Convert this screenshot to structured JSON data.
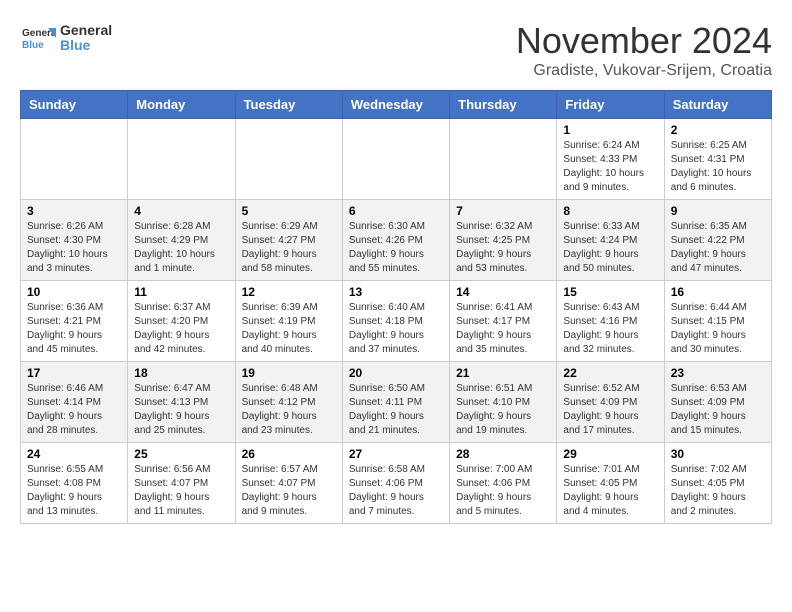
{
  "logo": {
    "text_general": "General",
    "text_blue": "Blue"
  },
  "title": "November 2024",
  "subtitle": "Gradiste, Vukovar-Srijem, Croatia",
  "weekdays": [
    "Sunday",
    "Monday",
    "Tuesday",
    "Wednesday",
    "Thursday",
    "Friday",
    "Saturday"
  ],
  "weeks": [
    [
      {
        "day": "",
        "info": ""
      },
      {
        "day": "",
        "info": ""
      },
      {
        "day": "",
        "info": ""
      },
      {
        "day": "",
        "info": ""
      },
      {
        "day": "",
        "info": ""
      },
      {
        "day": "1",
        "info": "Sunrise: 6:24 AM\nSunset: 4:33 PM\nDaylight: 10 hours and 9 minutes."
      },
      {
        "day": "2",
        "info": "Sunrise: 6:25 AM\nSunset: 4:31 PM\nDaylight: 10 hours and 6 minutes."
      }
    ],
    [
      {
        "day": "3",
        "info": "Sunrise: 6:26 AM\nSunset: 4:30 PM\nDaylight: 10 hours and 3 minutes."
      },
      {
        "day": "4",
        "info": "Sunrise: 6:28 AM\nSunset: 4:29 PM\nDaylight: 10 hours and 1 minute."
      },
      {
        "day": "5",
        "info": "Sunrise: 6:29 AM\nSunset: 4:27 PM\nDaylight: 9 hours and 58 minutes."
      },
      {
        "day": "6",
        "info": "Sunrise: 6:30 AM\nSunset: 4:26 PM\nDaylight: 9 hours and 55 minutes."
      },
      {
        "day": "7",
        "info": "Sunrise: 6:32 AM\nSunset: 4:25 PM\nDaylight: 9 hours and 53 minutes."
      },
      {
        "day": "8",
        "info": "Sunrise: 6:33 AM\nSunset: 4:24 PM\nDaylight: 9 hours and 50 minutes."
      },
      {
        "day": "9",
        "info": "Sunrise: 6:35 AM\nSunset: 4:22 PM\nDaylight: 9 hours and 47 minutes."
      }
    ],
    [
      {
        "day": "10",
        "info": "Sunrise: 6:36 AM\nSunset: 4:21 PM\nDaylight: 9 hours and 45 minutes."
      },
      {
        "day": "11",
        "info": "Sunrise: 6:37 AM\nSunset: 4:20 PM\nDaylight: 9 hours and 42 minutes."
      },
      {
        "day": "12",
        "info": "Sunrise: 6:39 AM\nSunset: 4:19 PM\nDaylight: 9 hours and 40 minutes."
      },
      {
        "day": "13",
        "info": "Sunrise: 6:40 AM\nSunset: 4:18 PM\nDaylight: 9 hours and 37 minutes."
      },
      {
        "day": "14",
        "info": "Sunrise: 6:41 AM\nSunset: 4:17 PM\nDaylight: 9 hours and 35 minutes."
      },
      {
        "day": "15",
        "info": "Sunrise: 6:43 AM\nSunset: 4:16 PM\nDaylight: 9 hours and 32 minutes."
      },
      {
        "day": "16",
        "info": "Sunrise: 6:44 AM\nSunset: 4:15 PM\nDaylight: 9 hours and 30 minutes."
      }
    ],
    [
      {
        "day": "17",
        "info": "Sunrise: 6:46 AM\nSunset: 4:14 PM\nDaylight: 9 hours and 28 minutes."
      },
      {
        "day": "18",
        "info": "Sunrise: 6:47 AM\nSunset: 4:13 PM\nDaylight: 9 hours and 25 minutes."
      },
      {
        "day": "19",
        "info": "Sunrise: 6:48 AM\nSunset: 4:12 PM\nDaylight: 9 hours and 23 minutes."
      },
      {
        "day": "20",
        "info": "Sunrise: 6:50 AM\nSunset: 4:11 PM\nDaylight: 9 hours and 21 minutes."
      },
      {
        "day": "21",
        "info": "Sunrise: 6:51 AM\nSunset: 4:10 PM\nDaylight: 9 hours and 19 minutes."
      },
      {
        "day": "22",
        "info": "Sunrise: 6:52 AM\nSunset: 4:09 PM\nDaylight: 9 hours and 17 minutes."
      },
      {
        "day": "23",
        "info": "Sunrise: 6:53 AM\nSunset: 4:09 PM\nDaylight: 9 hours and 15 minutes."
      }
    ],
    [
      {
        "day": "24",
        "info": "Sunrise: 6:55 AM\nSunset: 4:08 PM\nDaylight: 9 hours and 13 minutes."
      },
      {
        "day": "25",
        "info": "Sunrise: 6:56 AM\nSunset: 4:07 PM\nDaylight: 9 hours and 11 minutes."
      },
      {
        "day": "26",
        "info": "Sunrise: 6:57 AM\nSunset: 4:07 PM\nDaylight: 9 hours and 9 minutes."
      },
      {
        "day": "27",
        "info": "Sunrise: 6:58 AM\nSunset: 4:06 PM\nDaylight: 9 hours and 7 minutes."
      },
      {
        "day": "28",
        "info": "Sunrise: 7:00 AM\nSunset: 4:06 PM\nDaylight: 9 hours and 5 minutes."
      },
      {
        "day": "29",
        "info": "Sunrise: 7:01 AM\nSunset: 4:05 PM\nDaylight: 9 hours and 4 minutes."
      },
      {
        "day": "30",
        "info": "Sunrise: 7:02 AM\nSunset: 4:05 PM\nDaylight: 9 hours and 2 minutes."
      }
    ]
  ]
}
